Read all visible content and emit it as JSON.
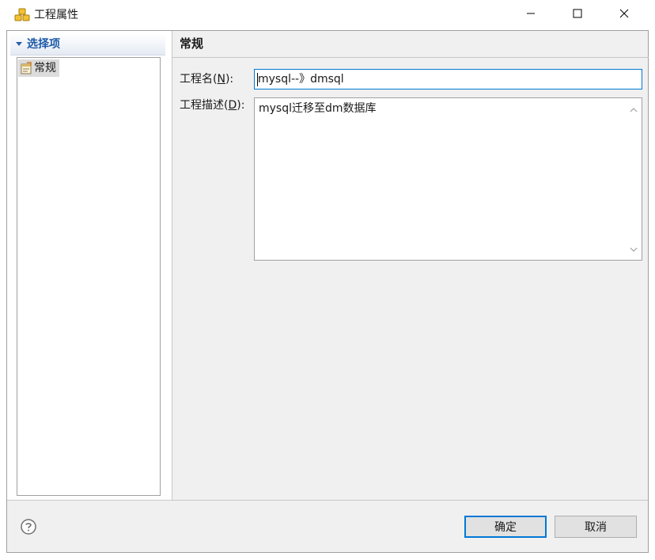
{
  "window": {
    "title": "工程属性"
  },
  "sidebar": {
    "header": "选择项",
    "items": [
      {
        "label": "常规"
      }
    ]
  },
  "main": {
    "section_title": "常规",
    "name_field": {
      "label_prefix": "工程名(",
      "mnemonic": "N",
      "label_suffix": "):",
      "value": "mysql--》dmsql"
    },
    "description_field": {
      "label_prefix": "工程描述(",
      "mnemonic": "D",
      "label_suffix": "):",
      "value": "mysql迁移至dm数据库"
    }
  },
  "footer": {
    "ok_label": "确定",
    "cancel_label": "取消"
  },
  "icons": {
    "app": "cubes-icon",
    "help": "question-circle-icon",
    "tree_item": "properties-page-icon"
  },
  "colors": {
    "accent": "#0078d7",
    "header_text": "#1e5aa8",
    "panel_bg": "#f0f0f0"
  }
}
